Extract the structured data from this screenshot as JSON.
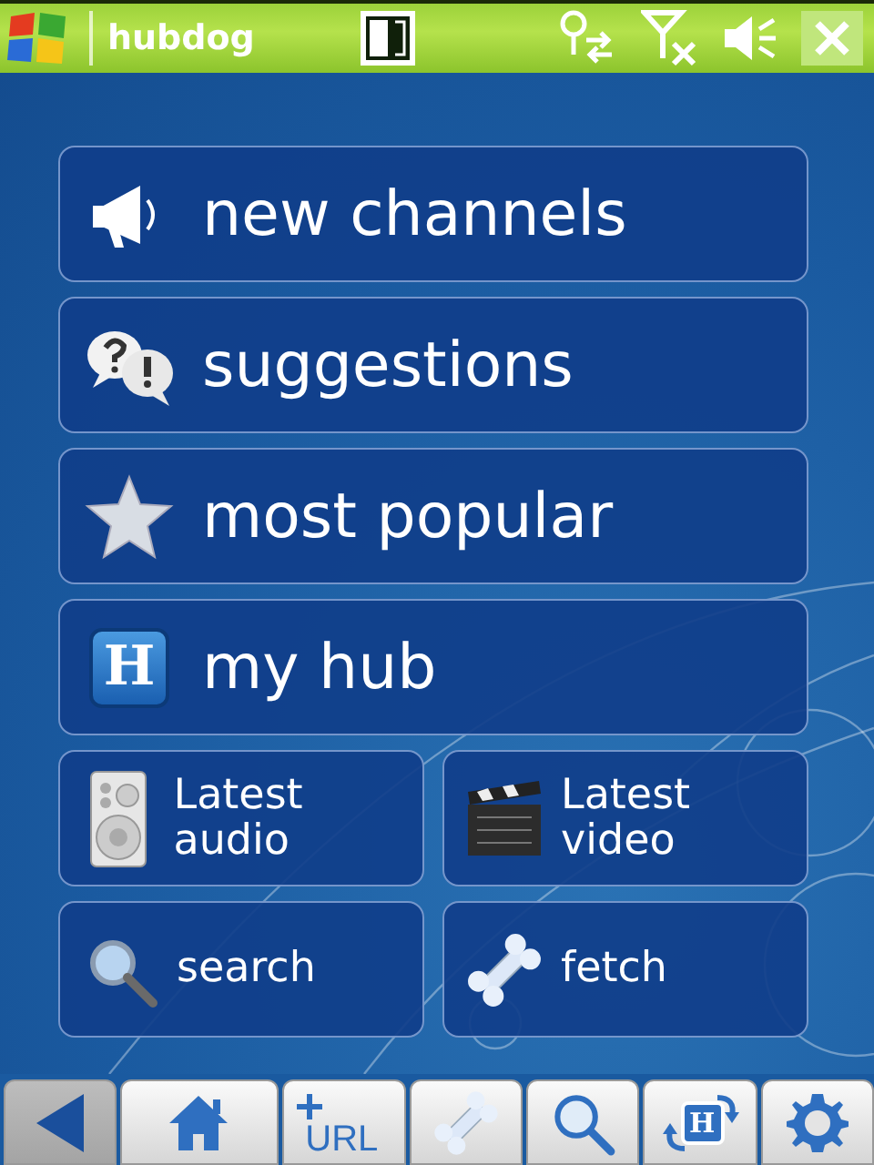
{
  "title_bar": {
    "title": "hubdog"
  },
  "large_buttons": [
    {
      "label": "new channels",
      "kind": "megaphone"
    },
    {
      "label": "suggestions",
      "kind": "bubbles"
    },
    {
      "label": "most popular",
      "kind": "star"
    },
    {
      "label": "my hub",
      "kind": "hub",
      "badge": "H"
    }
  ],
  "small_buttons": [
    {
      "label": "Latest audio",
      "kind": "speaker"
    },
    {
      "label": "Latest video",
      "kind": "clapper"
    },
    {
      "label": "search",
      "kind": "magnifier"
    },
    {
      "label": "fetch",
      "kind": "bone"
    }
  ],
  "toolbar": [
    {
      "kind": "back"
    },
    {
      "kind": "home"
    },
    {
      "kind": "add-url",
      "label": "URL"
    },
    {
      "kind": "bone"
    },
    {
      "kind": "magnifier"
    },
    {
      "kind": "hub-sync",
      "badge": "H"
    },
    {
      "kind": "gear"
    }
  ]
}
